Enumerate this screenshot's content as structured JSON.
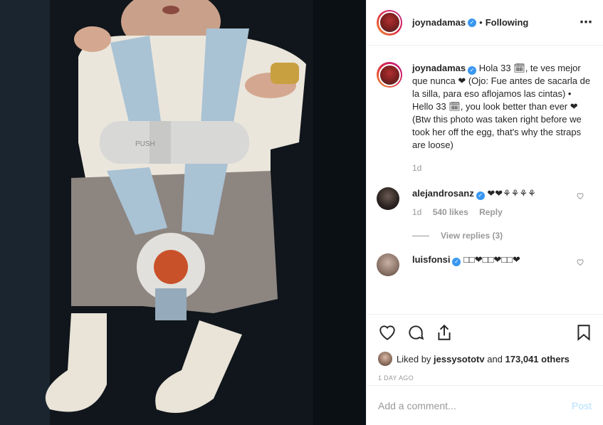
{
  "header": {
    "username": "joynadamas",
    "separator": "•",
    "follow_status": "Following",
    "more_icon": "⋯"
  },
  "caption": {
    "username": "joynadamas",
    "text": "Hola 33 🗓, te ves mejor que nunca ❤ (Ojo: Fue antes de sacarla de la silla, para eso aflojamos las cintas) • Hello 33 🗓, you look better than ever ❤ (Btw this photo was taken right before we took her off the egg, that's why the straps are loose)",
    "time": "1d"
  },
  "comments": [
    {
      "username": "alejandrosanz",
      "text": "❤❤⚘⚘⚘⚘",
      "time": "1d",
      "likes": "540 likes",
      "reply": "Reply",
      "view_replies": "View replies (3)"
    },
    {
      "username": "luisfonsi",
      "text": "□□❤□□❤□□❤"
    }
  ],
  "likes": {
    "prefix": "Liked by",
    "user": "jessysototv",
    "middle": "and",
    "count": "173,041 others"
  },
  "timestamp": "1 DAY AGO",
  "add_comment": {
    "placeholder": "Add a comment...",
    "post": "Post"
  },
  "colors": {
    "verified": "#3897f0",
    "post_button_disabled": "#b2dffc"
  }
}
